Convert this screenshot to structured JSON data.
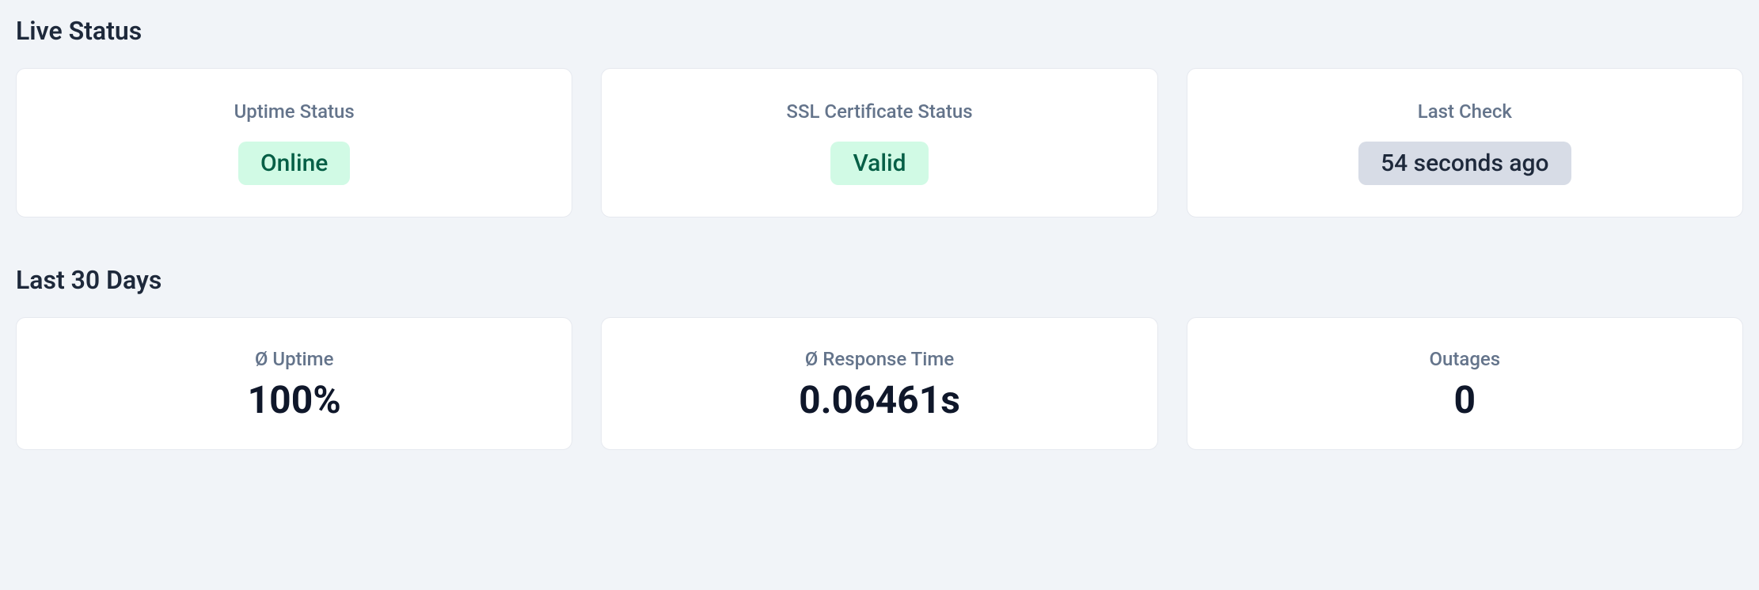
{
  "sections": {
    "live_status": {
      "title": "Live Status",
      "cards": {
        "uptime_status": {
          "label": "Uptime Status",
          "value": "Online"
        },
        "ssl_status": {
          "label": "SSL Certificate Status",
          "value": "Valid"
        },
        "last_check": {
          "label": "Last Check",
          "value": "54 seconds ago"
        }
      }
    },
    "last_30_days": {
      "title": "Last 30 Days",
      "cards": {
        "avg_uptime": {
          "label": "Ø Uptime",
          "value": "100%"
        },
        "avg_response": {
          "label": "Ø Response Time",
          "value": "0.06461s"
        },
        "outages": {
          "label": "Outages",
          "value": "0"
        }
      }
    }
  }
}
